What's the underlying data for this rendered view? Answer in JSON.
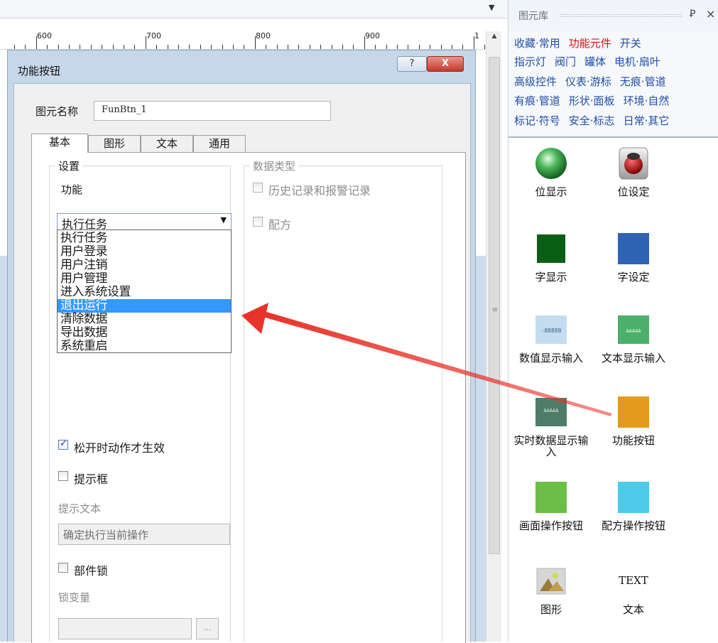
{
  "dialog": {
    "title": "功能按钮",
    "help_label": "?",
    "close_label": "X",
    "name_label": "图元名称",
    "name_value": "FunBtn_1",
    "tabs": [
      "基本",
      "图形",
      "文本",
      "通用"
    ],
    "settings": {
      "legend": "设置",
      "function_label": "功能",
      "function_selected": "执行任务",
      "function_options": [
        "执行任务",
        "用户登录",
        "用户注销",
        "用户管理",
        "进入系统设置",
        "退出运行",
        "清除数据",
        "导出数据",
        "系统重启"
      ],
      "highlighted_option": "退出运行",
      "release_action_label": "松开时动作才生效",
      "release_action_checked": true,
      "prompt_box_label": "提示框",
      "prompt_box_checked": false,
      "prompt_text_label": "提示文本",
      "prompt_text_value": "确定执行当前操作",
      "component_lock_label": "部件锁",
      "component_lock_checked": false,
      "lock_variable_label": "锁变量",
      "lock_variable_button": "..."
    },
    "data_type": {
      "legend": "数据类型",
      "history_alarm_label": "历史记录和报警记录",
      "history_alarm_checked": false,
      "recipe_label": "配方",
      "recipe_checked": false
    }
  },
  "ruler": {
    "labels": [
      "600",
      "700",
      "800",
      "900",
      "1"
    ]
  },
  "library": {
    "title": "图元库",
    "pin_icon": "pin-icon",
    "close_icon": "close-icon",
    "categories": [
      [
        {
          "label": "收藏·常用"
        },
        {
          "label": "功能元件",
          "active": true
        },
        {
          "label": "开关"
        }
      ],
      [
        {
          "label": "指示灯"
        },
        {
          "label": "阀门"
        },
        {
          "label": "罐体"
        },
        {
          "label": "电机·扇叶"
        }
      ],
      [
        {
          "label": "高级控件"
        },
        {
          "label": "仪表·游标"
        },
        {
          "label": "无痕·管道"
        }
      ],
      [
        {
          "label": "有痕·管道"
        },
        {
          "label": "形状·面板"
        },
        {
          "label": "环境·自然"
        }
      ],
      [
        {
          "label": "标记·符号"
        },
        {
          "label": "安全·标志"
        },
        {
          "label": "日常·其它"
        }
      ]
    ],
    "items": [
      {
        "label": "位显示",
        "icon": "green-lamp-icon",
        "color": "#2f9a3a"
      },
      {
        "label": "位设定",
        "icon": "red-button-icon",
        "color": "#b80f0f"
      },
      {
        "label": "字显示",
        "icon": "dark-green-square-icon",
        "color": "#0b5e16"
      },
      {
        "label": "字设定",
        "icon": "blue-square-icon",
        "color": "#2e64b3"
      },
      {
        "label": "数值显示输入",
        "icon": "numeric-display-icon",
        "color": "#c4dcef",
        "icon_text": "-88888"
      },
      {
        "label": "文本显示输入",
        "icon": "text-display-icon",
        "color": "#4caf6c",
        "icon_text": "AAAAA"
      },
      {
        "label": "实时数据显示输入",
        "icon": "realtime-data-icon",
        "color": "#4f7c6a",
        "icon_text": "AAAAA"
      },
      {
        "label": "功能按钮",
        "icon": "orange-square-icon",
        "color": "#e69a1c"
      },
      {
        "label": "画面操作按钮",
        "icon": "light-green-square-icon",
        "color": "#6bbf47"
      },
      {
        "label": "配方操作按钮",
        "icon": "cyan-square-icon",
        "color": "#4ecbe8"
      },
      {
        "label": "图形",
        "icon": "picture-icon",
        "color": "#c8c8c8"
      },
      {
        "label": "文本",
        "icon": "text-icon",
        "icon_text": "TEXT"
      }
    ]
  },
  "annotation": {
    "arrow_color": "#e8332a"
  }
}
